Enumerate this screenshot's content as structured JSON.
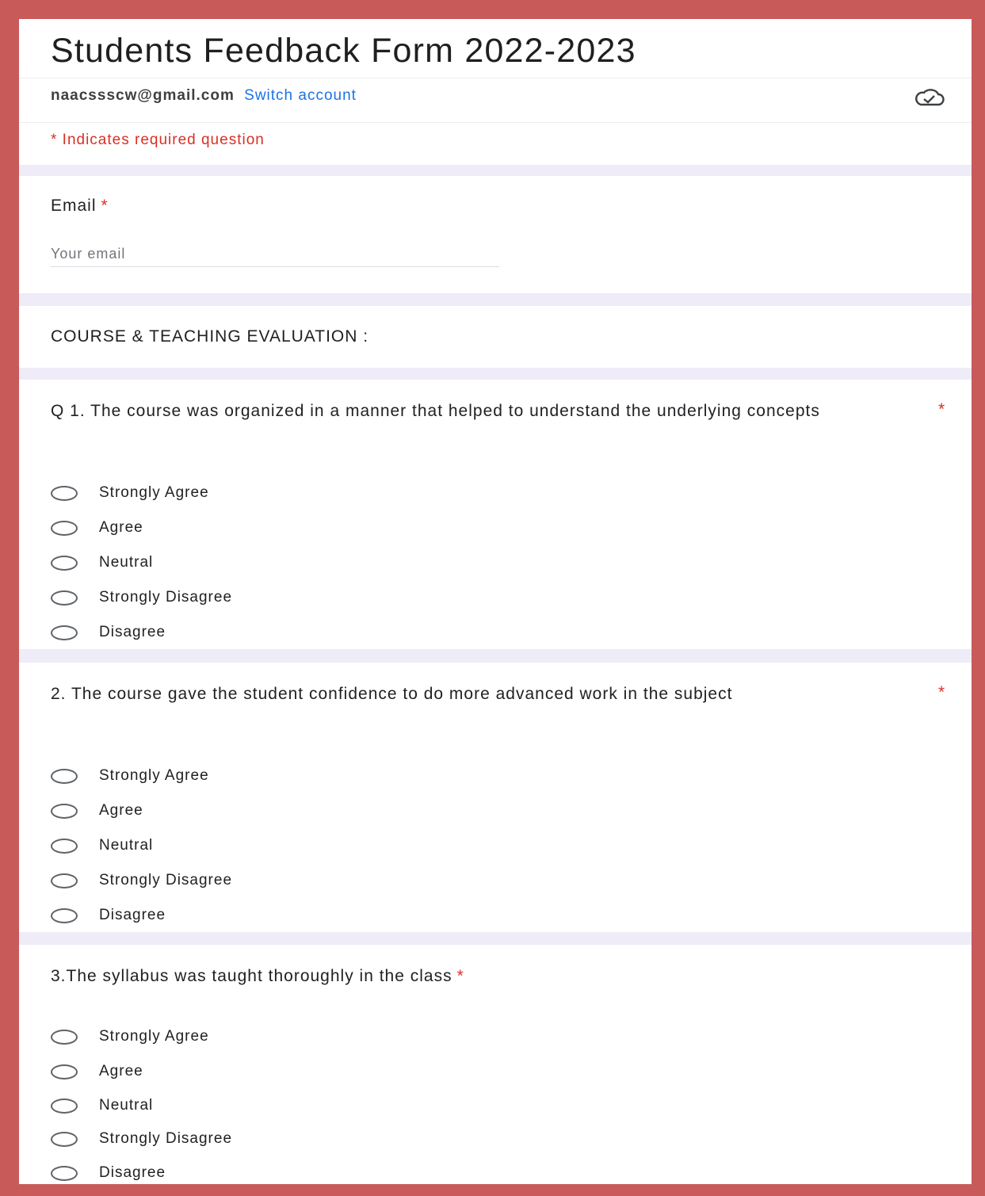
{
  "form": {
    "title": "Students Feedback Form 2022-2023",
    "account_email": "naacssscw@gmail.com",
    "switch_account": "Switch account",
    "required_note": "* Indicates required question",
    "required_marker": "*"
  },
  "email_field": {
    "label": "Email",
    "placeholder": "Your email",
    "value": ""
  },
  "section": {
    "title": "COURSE & TEACHING EVALUATION :"
  },
  "questions": [
    {
      "text": "Q 1. The course was organized in a manner that helped to understand the underlying concepts",
      "options": [
        "Strongly Agree",
        "Agree",
        "Neutral",
        "Strongly Disagree",
        "Disagree"
      ]
    },
    {
      "text": "2. The course gave the student confidence to do more advanced work in the subject",
      "options": [
        "Strongly Agree",
        "Agree",
        "Neutral",
        "Strongly Disagree",
        "Disagree"
      ]
    },
    {
      "text": "3.The syllabus was taught thoroughly in the class",
      "options": [
        "Strongly Agree",
        "Agree",
        "Neutral",
        "Strongly Disagree",
        "Disagree"
      ]
    }
  ],
  "colors": {
    "frame": "#c85a5a",
    "page_background": "#efebf7",
    "link": "#1a73e8",
    "required": "#d93025"
  }
}
